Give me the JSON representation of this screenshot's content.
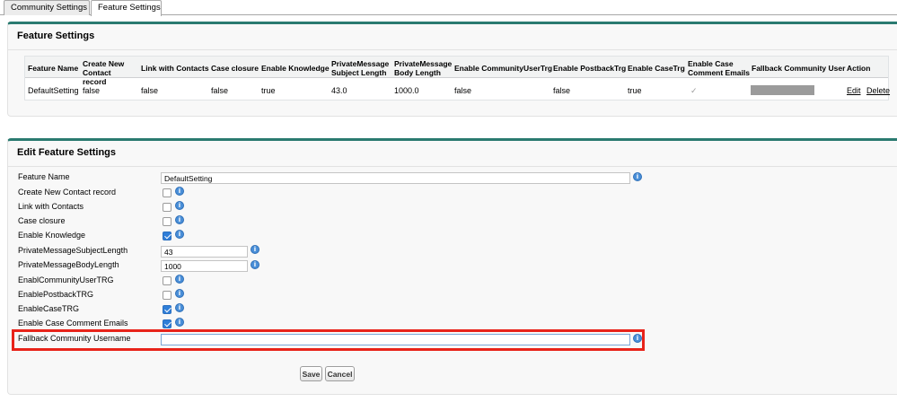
{
  "tabs": [
    "Community Settings",
    "Feature Settings"
  ],
  "list_panel": {
    "title": "Feature Settings",
    "columns": [
      "Feature Name",
      "Create New Contact record",
      "Link with Contacts",
      "Case closure",
      "Enable Knowledge",
      "PrivateMessage Subject Length",
      "PrivateMessage Body Length",
      "Enable CommunityUserTrg",
      "Enable PostbackTrg",
      "Enable CaseTrg",
      "Enable Case Comment Emails",
      "Fallback Community User",
      "Action"
    ],
    "row": {
      "feature_name": "DefaultSetting",
      "create_new_contact": "false",
      "link_with_contacts": "false",
      "case_closure": "false",
      "enable_knowledge": "true",
      "pm_subject_length": "43.0",
      "pm_body_length": "1000.0",
      "enable_community_user_trg": "false",
      "enable_postback_trg": "false",
      "enable_case_trg": "true",
      "enable_case_comment_emails": "✓",
      "edit": "Edit",
      "delete": "Delete"
    }
  },
  "edit_panel": {
    "title": "Edit Feature Settings",
    "labels": {
      "feature_name": "Feature Name",
      "create_new_contact": "Create New Contact record",
      "link_with_contacts": "Link with Contacts",
      "case_closure": "Case closure",
      "enable_knowledge": "Enable Knowledge",
      "pm_subject_length": "PrivateMessageSubjectLength",
      "pm_body_length": "PrivateMessageBodyLength",
      "enable_community_user_trg": "EnablCommunityUserTRG",
      "enable_postback_trg": "EnablePostbackTRG",
      "enable_case_trg": "EnableCaseTRG",
      "enable_case_comment_emails": "Enable Case Comment Emails",
      "fallback_username": "Fallback Community Username"
    },
    "values": {
      "feature_name": "DefaultSetting",
      "pm_subject_length": "43",
      "pm_body_length": "1000",
      "fallback_username": ""
    },
    "checkboxes": {
      "create_new_contact": false,
      "link_with_contacts": false,
      "case_closure": false,
      "enable_knowledge": true,
      "enable_community_user_trg": false,
      "enable_postback_trg": false,
      "enable_case_trg": true,
      "enable_case_comment_emails": true
    },
    "info_glyph": "i",
    "save_label": "Save",
    "cancel_label": "Cancel"
  },
  "colors": {
    "accent_border": "#2a7a70",
    "highlight": "#e8231a",
    "checkbox_checked": "#2f7ed8"
  }
}
